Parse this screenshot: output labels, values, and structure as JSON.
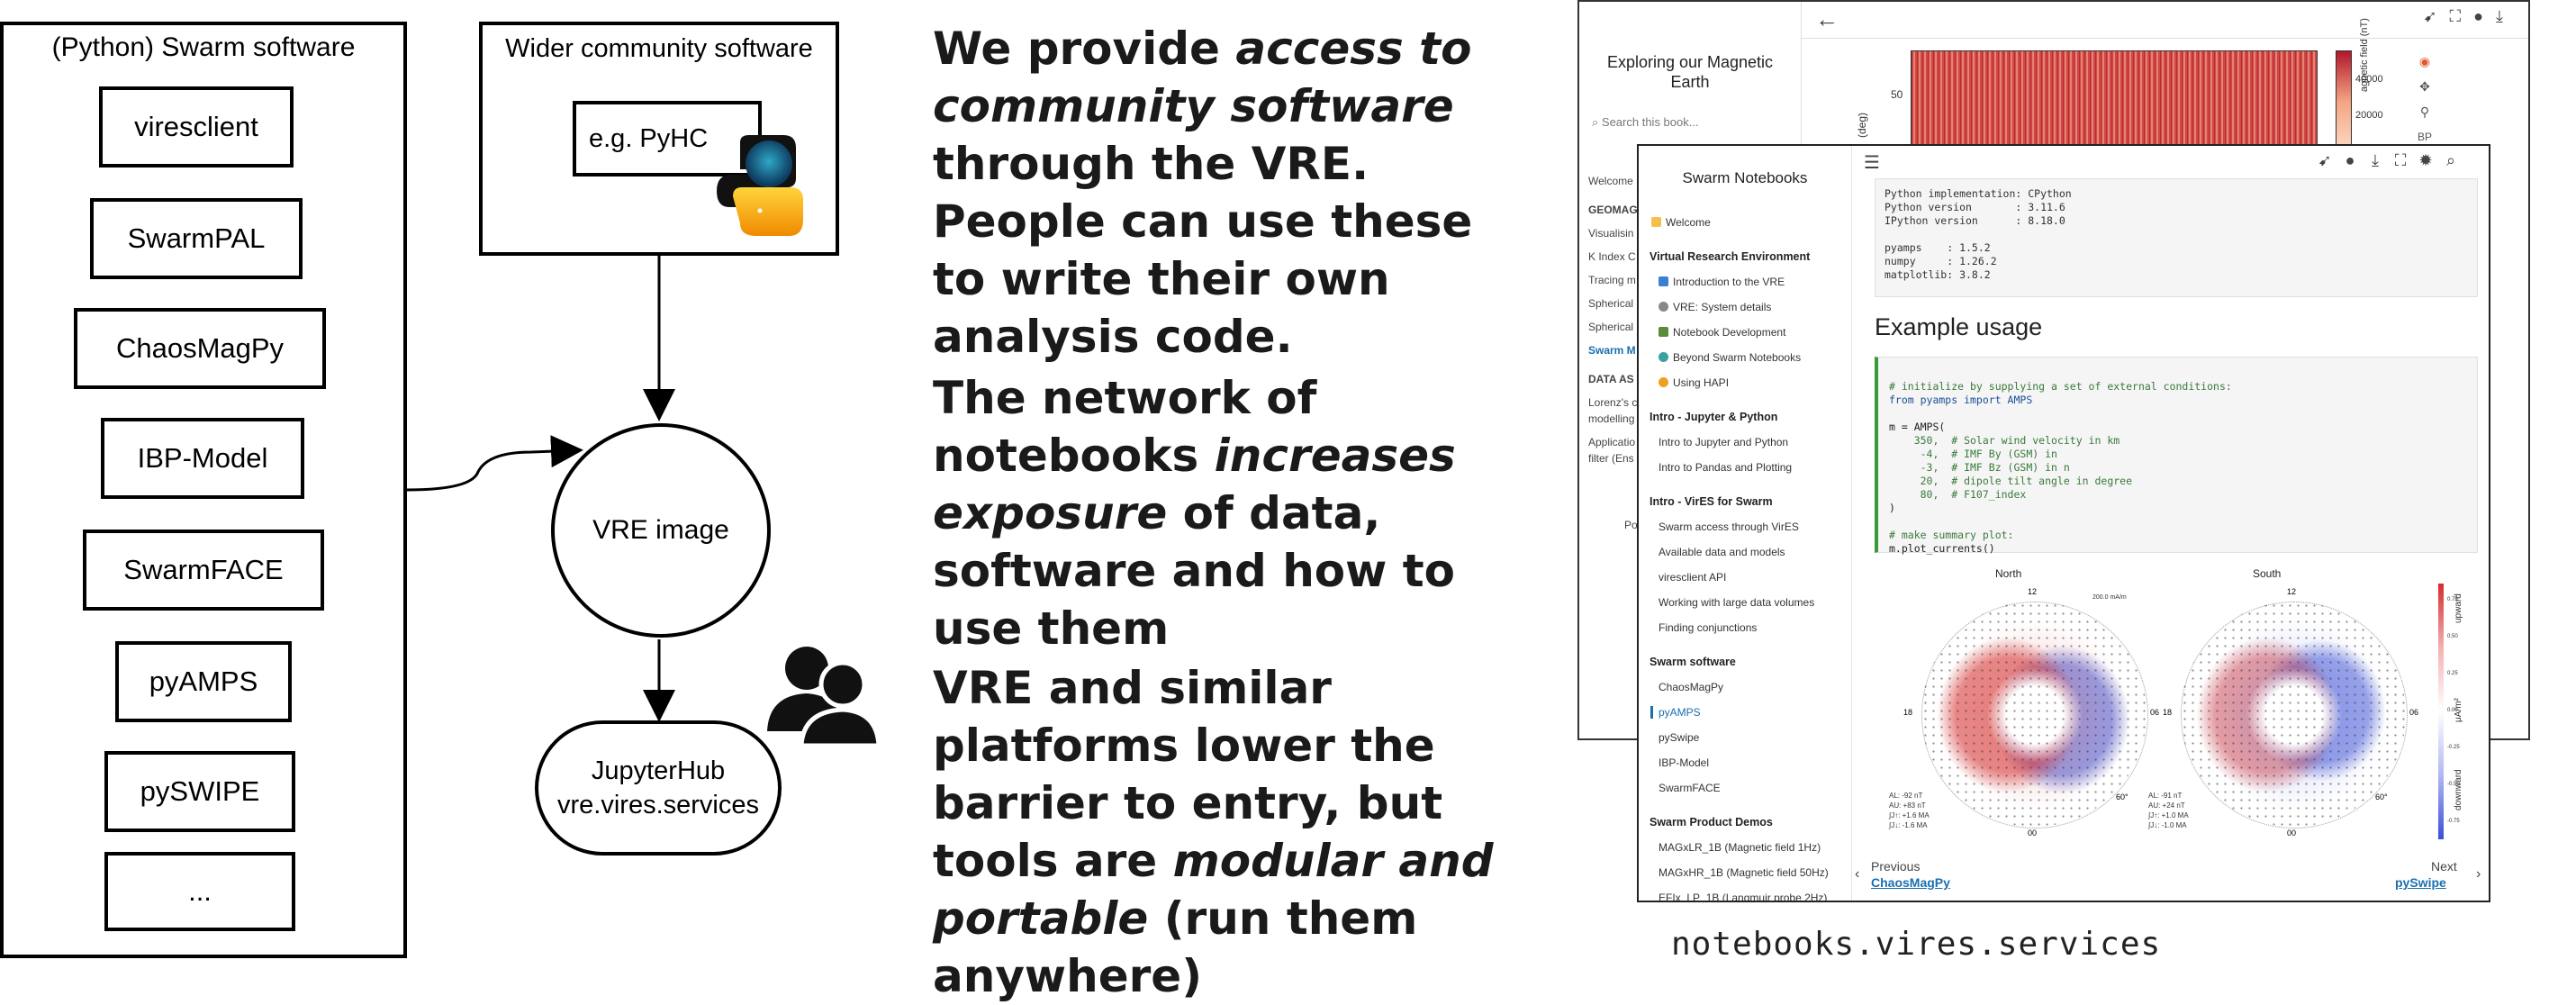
{
  "diagram": {
    "swarm_box_title": "(Python) Swarm software",
    "packages": [
      "viresclient",
      "SwarmPAL",
      "ChaosMagPy",
      "IBP-Model",
      "SwarmFACE",
      "pyAMPS",
      "pySWIPE",
      "..."
    ],
    "community_box_title": "Wider community software",
    "community_example": "e.g. PyHC",
    "vre_node": "VRE image",
    "hub_line1": "JupyterHub",
    "hub_line2": "vre.vires.services"
  },
  "text": {
    "p1_a": "We provide ",
    "p1_b": "access to community software",
    "p1_c": " through the VRE. People can use these to write their own analysis code.",
    "p2_a": "The network of notebooks ",
    "p2_b": "increases exposure",
    "p2_c": " of data, software and how to use them",
    "p3_a": "VRE and similar platforms lower the barrier to entry, but tools are ",
    "p3_b": "modular and portable",
    "p3_c": " (run them anywhere)"
  },
  "back_screenshot": {
    "book_title": "Exploring our Magnetic Earth",
    "search_placeholder": "Search this book...",
    "nav_welcome": "Welcome",
    "nav_section1": "GEOMAG",
    "nav_items1": [
      "Visualisin",
      "K Index C",
      "Tracing m",
      "Spherical",
      "Spherical",
      "Swarm M"
    ],
    "nav_section2": "DATA AS",
    "nav_items2": [
      "Lorenz's c",
      "modelling",
      "Applicatio",
      "filter (Ens"
    ],
    "footer_frag": "Po",
    "y_tick": "50",
    "y_axis_label": "(deg)",
    "colorbar_label": "agnetic field (nT)",
    "colorbar_ticks": [
      "40000",
      "20000"
    ],
    "tool_badge": "BP"
  },
  "front_screenshot": {
    "sidebar_title": "Swarm Notebooks",
    "welcome": "Welcome",
    "sections": [
      {
        "title": "Virtual Research Environment",
        "items": [
          "Introduction to the VRE",
          "VRE: System details",
          "Notebook Development",
          "Beyond Swarm Notebooks",
          "Using HAPI"
        ]
      },
      {
        "title": "Intro - Jupyter & Python",
        "items": [
          "Intro to Jupyter and Python",
          "Intro to Pandas and Plotting"
        ]
      },
      {
        "title": "Intro - VirES for Swarm",
        "items": [
          "Swarm access through VirES",
          "Available data and models",
          "viresclient API",
          "Working with large data volumes",
          "Finding conjunctions"
        ]
      },
      {
        "title": "Swarm software",
        "items": [
          "ChaosMagPy",
          "pyAMPS",
          "pySwipe",
          "IBP-Model",
          "SwarmFACE"
        ]
      },
      {
        "title": "Swarm Product Demos",
        "items": [
          "MAGxLR_1B (Magnetic field 1Hz)",
          "MAGxHR_1B (Magnetic field 50Hz)",
          "EFIx_LP_1B (Langmuir probe 2Hz)"
        ]
      }
    ],
    "active_item": "pyAMPS",
    "code_top": [
      "Python implementation: CPython",
      "Python version       : 3.11.6",
      "IPython version      : 8.18.0",
      "",
      "pyamps    : 1.5.2",
      "numpy     : 1.26.2",
      "matplotlib: 3.8.2"
    ],
    "heading": "Example usage",
    "code_main": [
      "# initialize by supplying a set of external conditions:",
      "from pyamps import AMPS",
      "",
      "m = AMPS(",
      "    350,  # Solar wind velocity in km",
      "     -4,  # IMF By (GSM) in",
      "     -3,  # IMF Bz (GSM) in n",
      "     20,  # dipole tilt angle in degree",
      "     80,  # F107_index",
      ")",
      "",
      "# make summary plot:",
      "m.plot_currents()"
    ],
    "plot_north": "North",
    "plot_south": "South",
    "pole_labels": {
      "top": "12",
      "left": "18",
      "right": "06",
      "bottom": "00",
      "lat": "60°"
    },
    "scale_text": "200.0 mA/m",
    "colorbar_units": "μA/m²",
    "colorbar_up": "upward",
    "colorbar_down": "downward",
    "cb_ticks": [
      "0.75",
      "0.50",
      "0.25",
      "0.00",
      "-0.25",
      "-0.50",
      "-0.75"
    ],
    "north_stats": [
      "AL:    -92 nT",
      "AU:    +83 nT",
      "∫J↑:  +1.6 MA",
      "∫J↓:  -1.6 MA"
    ],
    "south_stats": [
      "AL:    -91 nT",
      "AU:    +24 nT",
      "∫J↑:  +1.0 MA",
      "∫J↓:  -1.0 MA"
    ],
    "prev_label": "Previous",
    "prev_link": "ChaosMagPy",
    "next_label": "Next",
    "next_link": "pySwipe"
  },
  "url_caption": "notebooks.vires.services",
  "colors": {
    "accent_green": "#3a9a3a",
    "link_blue": "#1a6fb0",
    "upward_red": "#d62c2c",
    "downward_blue": "#3a4fd6"
  }
}
